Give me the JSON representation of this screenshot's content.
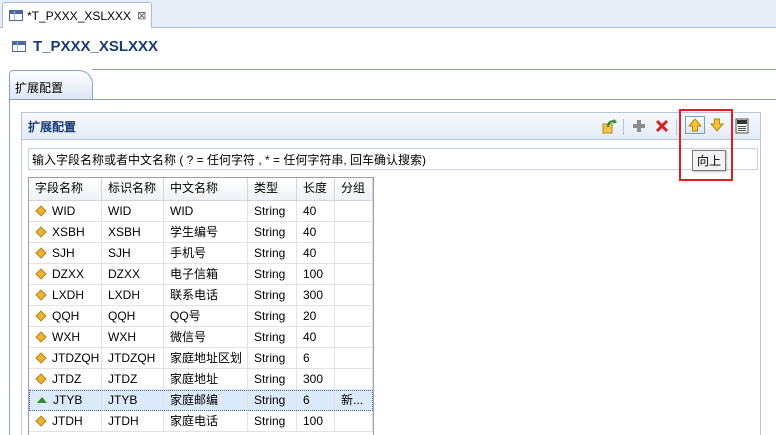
{
  "editor_tab": {
    "label": "*T_PXXX_XSLXXX",
    "close_glyph": "⊠"
  },
  "header": {
    "title": "T_PXXX_XSLXXX"
  },
  "form_tab": {
    "label": "扩展配置"
  },
  "section": {
    "title": "扩展配置",
    "toolbar": {
      "refresh_icon": "refresh-icon",
      "add_icon": "add-icon",
      "delete_icon": "delete-icon",
      "move_up_icon": "arrow-up-icon",
      "move_down_icon": "arrow-down-icon",
      "sql_icon": "sql-icon",
      "tooltip": "向上"
    },
    "filter_placeholder": "输入字段名称或者中文名称 ( ? = 任何字符 , * = 任何字符串, 回车确认搜索)"
  },
  "table": {
    "columns": [
      "字段名称",
      "标识名称",
      "中文名称",
      "类型",
      "长度",
      "分组"
    ],
    "rows": [
      {
        "name": "WID",
        "ident": "WID",
        "cn": "WID",
        "type": "String",
        "len": "40",
        "group": "",
        "icon": "diamond-icon"
      },
      {
        "name": "XSBH",
        "ident": "XSBH",
        "cn": "学生编号",
        "type": "String",
        "len": "40",
        "group": "",
        "icon": "diamond-icon"
      },
      {
        "name": "SJH",
        "ident": "SJH",
        "cn": "手机号",
        "type": "String",
        "len": "40",
        "group": "",
        "icon": "diamond-icon"
      },
      {
        "name": "DZXX",
        "ident": "DZXX",
        "cn": "电子信箱",
        "type": "String",
        "len": "100",
        "group": "",
        "icon": "diamond-icon"
      },
      {
        "name": "LXDH",
        "ident": "LXDH",
        "cn": "联系电话",
        "type": "String",
        "len": "300",
        "group": "",
        "icon": "diamond-icon"
      },
      {
        "name": "QQH",
        "ident": "QQH",
        "cn": "QQ号",
        "type": "String",
        "len": "20",
        "group": "",
        "icon": "diamond-icon"
      },
      {
        "name": "WXH",
        "ident": "WXH",
        "cn": "微信号",
        "type": "String",
        "len": "40",
        "group": "",
        "icon": "diamond-icon"
      },
      {
        "name": "JTDZQH",
        "ident": "JTDZQH",
        "cn": "家庭地址区划",
        "type": "String",
        "len": "6",
        "group": "",
        "icon": "diamond-icon"
      },
      {
        "name": "JTDZ",
        "ident": "JTDZ",
        "cn": "家庭地址",
        "type": "String",
        "len": "300",
        "group": "",
        "icon": "diamond-icon"
      },
      {
        "name": "JTYB",
        "ident": "JTYB",
        "cn": "家庭邮编",
        "type": "String",
        "len": "6",
        "group": "新...",
        "icon": "triangle-up-icon",
        "selected": true
      },
      {
        "name": "JTDH",
        "ident": "JTDH",
        "cn": "家庭电话",
        "type": "String",
        "len": "100",
        "group": "",
        "icon": "diamond-icon"
      }
    ]
  },
  "colors": {
    "title": "#193d72",
    "highlight": "#e02020",
    "selection": "#dcebfc"
  }
}
